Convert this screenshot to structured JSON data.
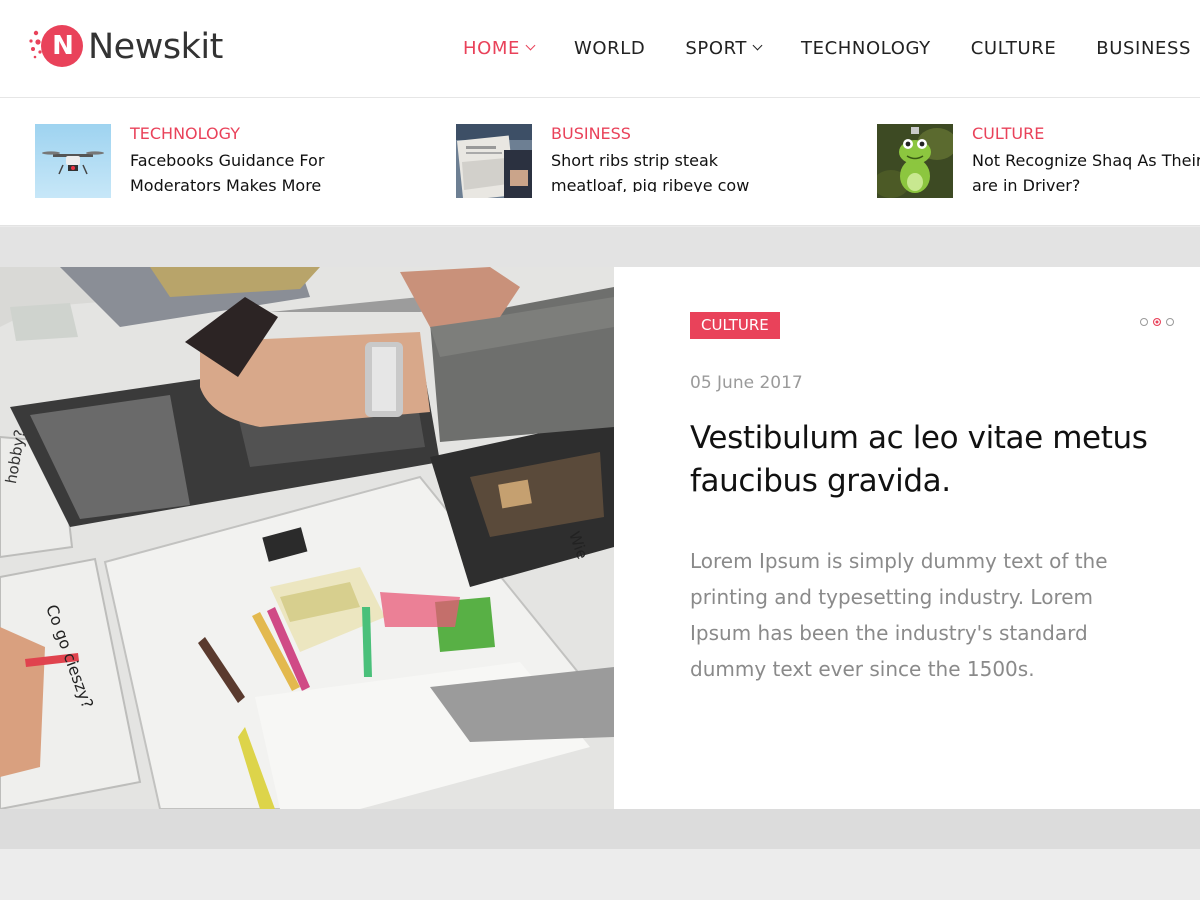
{
  "site": {
    "name": "Newskit",
    "logo_letter": "N"
  },
  "colors": {
    "accent": "#e9425a",
    "text": "#222222",
    "muted": "#8a8a8a",
    "band": "#e3e3e3"
  },
  "nav": {
    "items": [
      {
        "label": "HOME",
        "dropdown": true,
        "active": true
      },
      {
        "label": "WORLD",
        "dropdown": false,
        "active": false
      },
      {
        "label": "SPORT",
        "dropdown": true,
        "active": false
      },
      {
        "label": "TECHNOLOGY",
        "dropdown": false,
        "active": false
      },
      {
        "label": "CULTURE",
        "dropdown": false,
        "active": false
      },
      {
        "label": "BUSINESS",
        "dropdown": false,
        "active": false
      }
    ]
  },
  "ticker": {
    "items": [
      {
        "category": "TECHNOLOGY",
        "title": "Facebooks Guidance For Moderators Makes More",
        "thumb": "drone-image"
      },
      {
        "category": "BUSINESS",
        "title": "Short ribs strip steak meatloaf, pig ribeye cow turkey",
        "thumb": "newspaper-image"
      },
      {
        "category": "CULTURE",
        "title": "Not Recognize Shaq As Their are in Driver?",
        "thumb": "frog-figurine-image"
      }
    ]
  },
  "featured": {
    "category": "CULTURE",
    "date": "05 June 2017",
    "title": "Vestibulum ac leo vitae metus faucibus gravida.",
    "excerpt": "Lorem Ipsum is simply dummy text of the printing and typesetting industry. Lorem Ipsum has been the industry's standard dummy text ever since the 1500s.",
    "slide_count": 3,
    "active_slide": 2,
    "image": "magazine-collage-image",
    "image_texts": {
      "label_1": "Co go cieszy?",
      "label_2": "hobby?",
      "label_3": "Wie"
    }
  }
}
